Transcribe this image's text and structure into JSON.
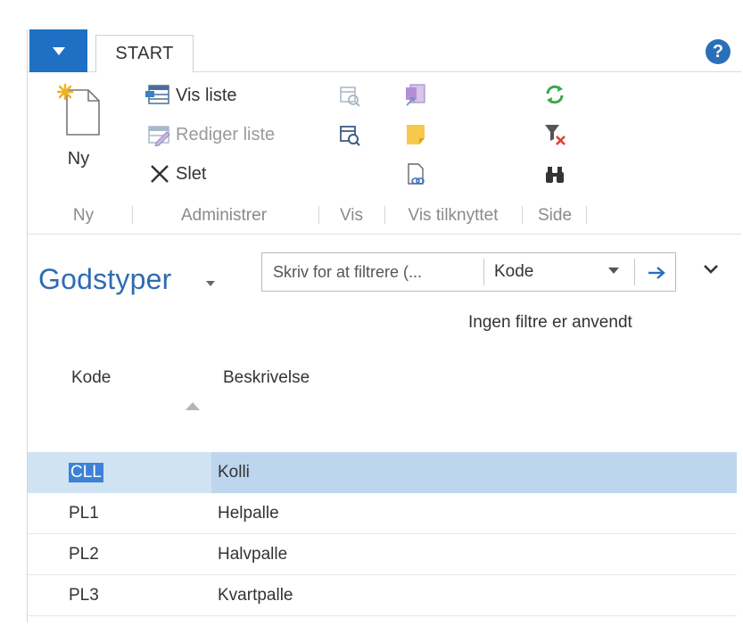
{
  "ribbon": {
    "tab_start": "START",
    "groups": {
      "new": {
        "label": "Ny",
        "new_label": "Ny"
      },
      "manage": {
        "label": "Administrer",
        "view_list": "Vis liste",
        "edit_list": "Rediger liste",
        "delete": "Slet"
      },
      "view": {
        "label": "Vis"
      },
      "related": {
        "label": "Vis tilknyttet"
      },
      "page": {
        "label": "Side"
      }
    }
  },
  "page": {
    "title": "Godstyper",
    "filter": {
      "placeholder": "Skriv for at filtrere (...",
      "field": "Kode"
    },
    "no_filters": "Ingen filtre er anvendt"
  },
  "table": {
    "headers": {
      "code": "Kode",
      "description": "Beskrivelse"
    },
    "rows": [
      {
        "code": "CLL",
        "description": "Kolli"
      },
      {
        "code": "PL1",
        "description": "Helpalle"
      },
      {
        "code": "PL2",
        "description": "Halvpalle"
      },
      {
        "code": "PL3",
        "description": "Kvartpalle"
      }
    ]
  },
  "colors": {
    "accent": "#1f6fc5",
    "title": "#2f6cb3",
    "selected_row": "#cfe3f2",
    "selection": "#3d82d6"
  }
}
